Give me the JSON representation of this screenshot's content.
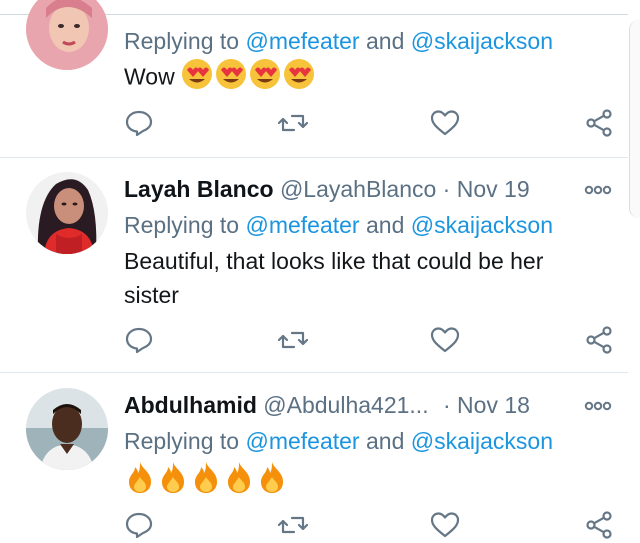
{
  "tweets": [
    {
      "name": "",
      "handle": "",
      "date": "",
      "replying_prefix": "Replying to",
      "mention1": "@mefeater",
      "and_word": "and",
      "mention2": "@skaijackson",
      "text": "Wow",
      "emojis": [
        "heart-eyes",
        "heart-eyes",
        "heart-eyes",
        "heart-eyes"
      ]
    },
    {
      "name": "Layah Blanco",
      "handle": "@LayahBlanco",
      "dot": "·",
      "date": "Nov 19",
      "replying_prefix": "Replying to",
      "mention1": "@mefeater",
      "and_word": "and",
      "mention2": "@skaijackson",
      "text_line1": "Beautiful, that looks like that could be her",
      "text_line2": "sister"
    },
    {
      "name": "Abdulhamid",
      "handle": "@Abdulha421...",
      "dot": "·",
      "date": "Nov 18",
      "replying_prefix": "Replying to",
      "mention1": "@mefeater",
      "and_word": "and",
      "mention2": "@skaijackson",
      "emojis": [
        "fire",
        "fire",
        "fire",
        "fire",
        "fire"
      ]
    }
  ],
  "colors": {
    "link": "#1b95e0",
    "muted": "#5b7083",
    "icon": "#657786",
    "divider": "#e1e8ed"
  }
}
